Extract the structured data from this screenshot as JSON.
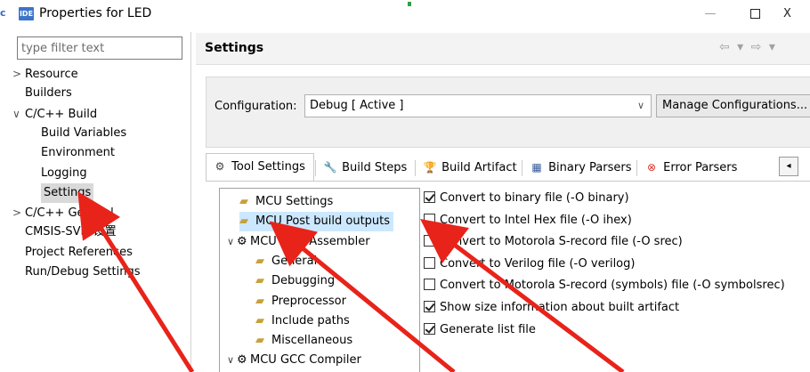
{
  "window": {
    "edge_glyph": "c",
    "icon_label": "IDE",
    "title": "Properties for LED",
    "minimize": "—",
    "close": "X"
  },
  "filter": {
    "placeholder": "type filter text"
  },
  "left_tree": [
    {
      "label": "Resource",
      "twisty": ">",
      "selected": false
    },
    {
      "label": "Builders",
      "twisty": "",
      "selected": false
    },
    {
      "label": "C/C++ Build",
      "twisty": "∨",
      "selected": false
    },
    {
      "label": "Build Variables",
      "twisty": "",
      "selected": false
    },
    {
      "label": "Environment",
      "twisty": "",
      "selected": false
    },
    {
      "label": "Logging",
      "twisty": "",
      "selected": false
    },
    {
      "label": "Settings",
      "twisty": "",
      "selected": true
    },
    {
      "label": "C/C++ General",
      "twisty": ">",
      "selected": false
    },
    {
      "label": "CMSIS-SVD 设置",
      "twisty": "",
      "selected": false
    },
    {
      "label": "Project References",
      "twisty": "",
      "selected": false
    },
    {
      "label": "Run/Debug Settings",
      "twisty": "",
      "selected": false
    }
  ],
  "settings": {
    "title": "Settings",
    "nav": "⇦ ▾ ⇨ ▾"
  },
  "configuration": {
    "label": "Configuration:",
    "value": "Debug  [ Active ]",
    "dropdown_icon": "∨",
    "manage_button": "Manage Configurations..."
  },
  "tabs": [
    {
      "label": "Tool Settings",
      "icon": "⚙",
      "active": true
    },
    {
      "label": "Build Steps",
      "icon": "🔧",
      "active": false
    },
    {
      "label": "Build Artifact",
      "icon": "🏆",
      "active": false
    },
    {
      "label": "Binary Parsers",
      "icon": "▦",
      "active": false
    },
    {
      "label": "Error Parsers",
      "icon": "⊗",
      "active": false
    }
  ],
  "tabs_scroll": "◂",
  "tool_tree": [
    {
      "label": "MCU Settings",
      "kind": "folder",
      "twisty": "",
      "selected": false
    },
    {
      "label": "MCU Post build outputs",
      "kind": "folder",
      "twisty": "",
      "selected": true
    },
    {
      "label": "MCU GCC Assembler",
      "kind": "gear",
      "twisty": "∨",
      "selected": false
    },
    {
      "label": "General",
      "kind": "folder",
      "twisty": "",
      "selected": false
    },
    {
      "label": "Debugging",
      "kind": "folder",
      "twisty": "",
      "selected": false
    },
    {
      "label": "Preprocessor",
      "kind": "folder",
      "twisty": "",
      "selected": false
    },
    {
      "label": "Include paths",
      "kind": "folder",
      "twisty": "",
      "selected": false
    },
    {
      "label": "Miscellaneous",
      "kind": "folder",
      "twisty": "",
      "selected": false
    },
    {
      "label": "MCU GCC Compiler",
      "kind": "gear",
      "twisty": "∨",
      "selected": false
    }
  ],
  "options": [
    {
      "label": "Convert to binary file (-O binary)",
      "checked": true
    },
    {
      "label": "Convert to Intel Hex file (-O ihex)",
      "checked": false
    },
    {
      "label": "Convert to Motorola S-record file (-O srec)",
      "checked": false
    },
    {
      "label": "Convert to Verilog file (-O verilog)",
      "checked": false
    },
    {
      "label": "Convert to Motorola S-record (symbols) file (-O symbolsrec)",
      "checked": false
    },
    {
      "label": "Show size information about built artifact",
      "checked": true
    },
    {
      "label": "Generate list file",
      "checked": true
    }
  ],
  "colors": {
    "annotation_arrow": "#e8231a",
    "selection_blue": "#cce8ff",
    "selection_gray": "#d9d9d9"
  }
}
